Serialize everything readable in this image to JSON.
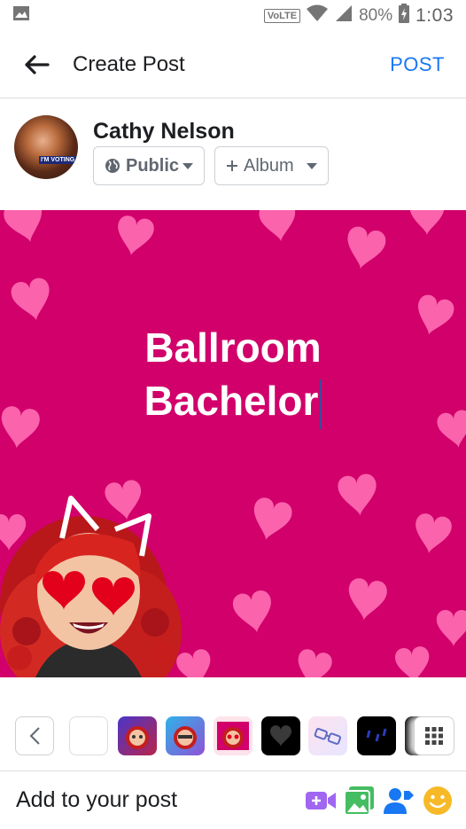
{
  "status_bar": {
    "network_label": "VoLTE",
    "battery": "80%",
    "time": "1:03"
  },
  "header": {
    "title": "Create Post",
    "post_label": "POST"
  },
  "user": {
    "name": "Cathy Nelson",
    "avatar_badge": "I'M VOTING",
    "privacy_label": "Public",
    "album_label": "Album"
  },
  "canvas": {
    "background_color": "#d1006b",
    "heart_color": "#ff6fb5",
    "text_line_1": "Ballroom",
    "text_line_2": "Bachelor"
  },
  "tray": {
    "items": [
      "back-icon",
      "blank-white",
      "bitmoji-purple",
      "bitmoji-blue",
      "bitmoji-hearts",
      "black-heart",
      "glasses",
      "rain-dark",
      "black-partial",
      "grid-icon"
    ]
  },
  "bottom": {
    "label": "Add to your post",
    "icons": [
      "video-icon",
      "photo-icon",
      "tag-people-icon",
      "feeling-icon"
    ]
  },
  "colors": {
    "accent": "#1877f2",
    "text": "#1c1e21",
    "muted": "#606770"
  }
}
